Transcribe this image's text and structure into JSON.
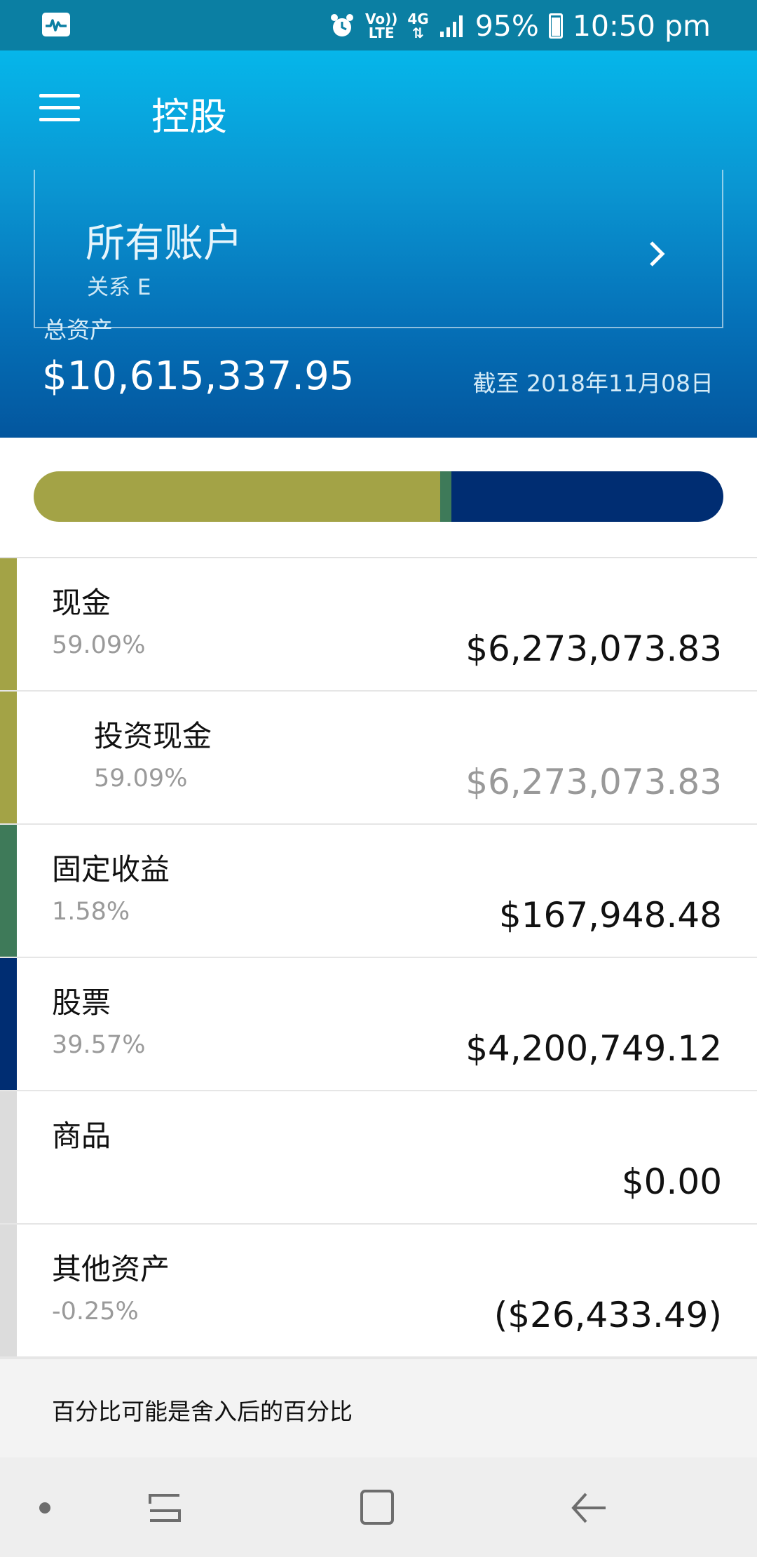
{
  "status_bar": {
    "lte_top": "Vo))",
    "lte_bottom": "LTE",
    "network": "4G",
    "battery": "95%",
    "time": "10:50 pm"
  },
  "header": {
    "title": "控股",
    "account_name": "所有账户",
    "account_relation": "关系 E",
    "total_label": "总资产",
    "total_value": "$10,615,337.95",
    "as_of": "截至 2018年11月08日"
  },
  "allocation": [
    {
      "name": "现金",
      "share": 0.5909,
      "color": "#a3a346"
    },
    {
      "name": "固定收益",
      "share": 0.0158,
      "color": "#3e7a59"
    },
    {
      "name": "股票",
      "share": 0.3957,
      "color": "#002d72"
    }
  ],
  "holdings": [
    {
      "name": "现金",
      "pct": "59.09%",
      "value": "$6,273,073.83",
      "color": "#a3a346"
    },
    {
      "name": "投资现金",
      "pct": "59.09%",
      "value": "$6,273,073.83",
      "color": "#a3a346"
    },
    {
      "name": "固定收益",
      "pct": "1.58%",
      "value": "$167,948.48",
      "color": "#3e7a59"
    },
    {
      "name": "股票",
      "pct": "39.57%",
      "value": "$4,200,749.12",
      "color": "#002d72"
    },
    {
      "name": "商品",
      "pct": "",
      "value": "$0.00",
      "color": "#dcdcdc"
    },
    {
      "name": "其他资产",
      "pct": "-0.25%",
      "value": "($26,433.49)",
      "color": "#dcdcdc"
    }
  ],
  "footnote": "百分比可能是舍入后的百分比",
  "icons": {
    "status_app": "activity-monitor-icon",
    "alarm": "alarm-icon",
    "signal": "signal-icon",
    "battery": "battery-icon",
    "menu": "hamburger-menu-icon",
    "chevron": "chevron-right-icon",
    "recents": "recents-icon",
    "home": "home-icon",
    "back": "back-arrow-icon"
  }
}
